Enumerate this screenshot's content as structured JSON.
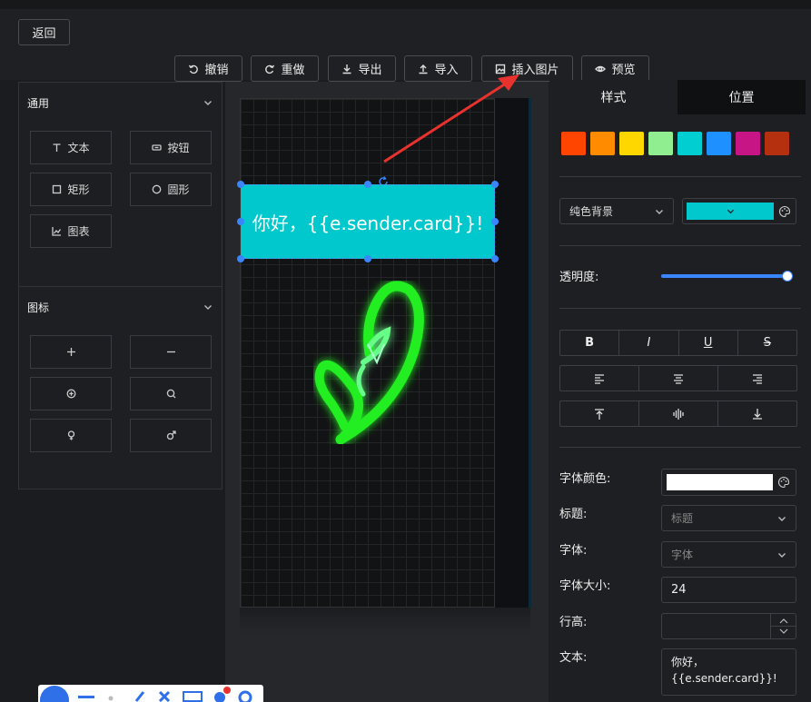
{
  "topbar": {
    "back_label": "返回",
    "toolbar": [
      {
        "id": "undo",
        "label": "撤销",
        "icon": "undo-icon"
      },
      {
        "id": "redo",
        "label": "重做",
        "icon": "redo-icon"
      },
      {
        "id": "export",
        "label": "导出",
        "icon": "download-icon"
      },
      {
        "id": "import",
        "label": "导入",
        "icon": "upload-icon"
      },
      {
        "id": "insert-image",
        "label": "插入图片",
        "icon": "image-icon"
      },
      {
        "id": "preview",
        "label": "预览",
        "icon": "eye-icon"
      }
    ]
  },
  "left_panel": {
    "general": {
      "title": "通用",
      "items": [
        {
          "label": "文本",
          "icon": "text-icon"
        },
        {
          "label": "按钮",
          "icon": "button-icon"
        },
        {
          "label": "矩形",
          "icon": "square-icon"
        },
        {
          "label": "圆形",
          "icon": "circle-icon"
        },
        {
          "label": "图表",
          "icon": "chart-icon"
        }
      ]
    },
    "icons": {
      "title": "图标",
      "items": [
        {
          "icon": "plus-icon"
        },
        {
          "icon": "minus-icon"
        },
        {
          "icon": "plus-circle-icon"
        },
        {
          "icon": "search-icon"
        },
        {
          "icon": "female-icon"
        },
        {
          "icon": "male-icon"
        }
      ]
    }
  },
  "canvas": {
    "text_element": "你好，{{e.sender.card}}!",
    "text_bg_color": "#00c8cc"
  },
  "right_panel": {
    "tabs": [
      {
        "label": "样式",
        "active": true
      },
      {
        "label": "位置",
        "active": false
      }
    ],
    "swatches": [
      "#ff4500",
      "#ff8c00",
      "#ffd700",
      "#90ee90",
      "#00ced1",
      "#1e90ff",
      "#c71585",
      "#b5300f"
    ],
    "background_type": "纯色背景",
    "background_color": "#00c8cc",
    "opacity_label": "透明度:",
    "opacity_value": 1.0,
    "style_buttons": [
      "B",
      "I",
      "U",
      "S"
    ],
    "align_buttons": [
      "align-left-icon",
      "align-center-icon",
      "align-right-icon"
    ],
    "valign_buttons": [
      "align-top-icon",
      "align-middle-icon",
      "align-bottom-icon"
    ],
    "font_color_label": "字体颜色:",
    "font_color": "#ffffff",
    "heading_label": "标题:",
    "heading_placeholder": "标题",
    "font_label": "字体:",
    "font_placeholder": "字体",
    "font_size_label": "字体大小:",
    "font_size_value": "24",
    "line_height_label": "行高:",
    "line_height_value": "",
    "text_label": "文本:",
    "text_value": "你好，\n{{e.sender.card}}!"
  }
}
